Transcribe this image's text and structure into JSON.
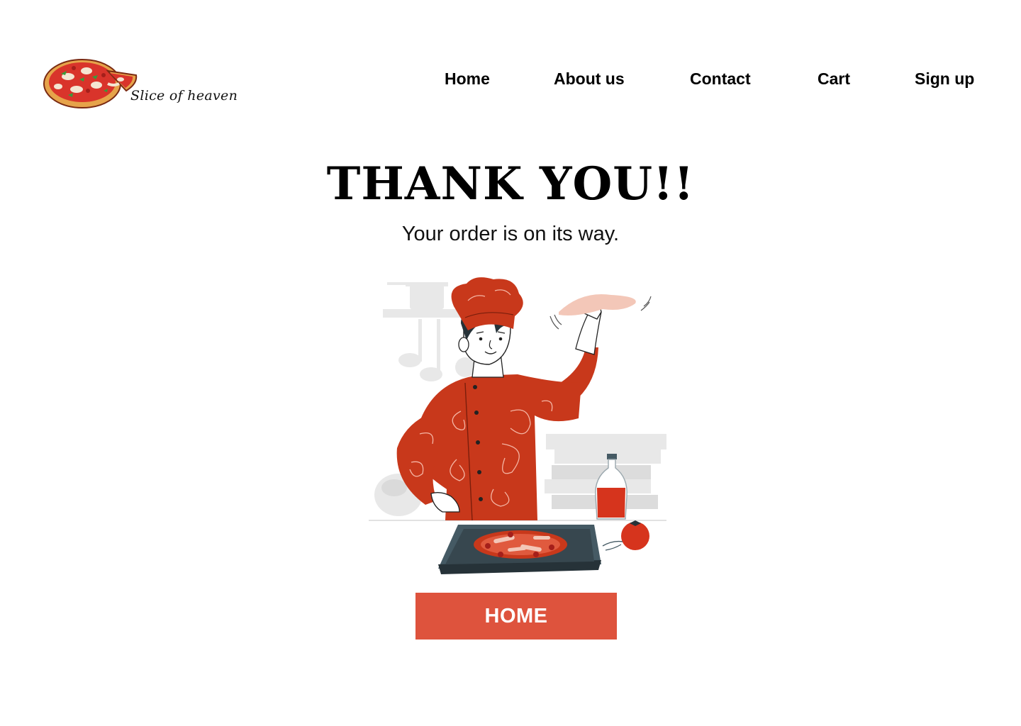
{
  "header": {
    "brand_name": "Slice of heaven",
    "nav": [
      {
        "label": "Home"
      },
      {
        "label": "About us"
      },
      {
        "label": "Contact"
      },
      {
        "label": "Cart"
      },
      {
        "label": "Sign up"
      }
    ]
  },
  "main": {
    "title": "THANK YOU!!",
    "subtitle": "Your order is on its way.",
    "home_button_label": "HOME"
  },
  "colors": {
    "accent": "#de533d",
    "chef_uniform": "#c8381b",
    "tray": "#455a64",
    "background": "#ffffff"
  },
  "icons": {
    "logo": "pizza-logo-icon",
    "illustration": "chef-pizza-illustration"
  }
}
